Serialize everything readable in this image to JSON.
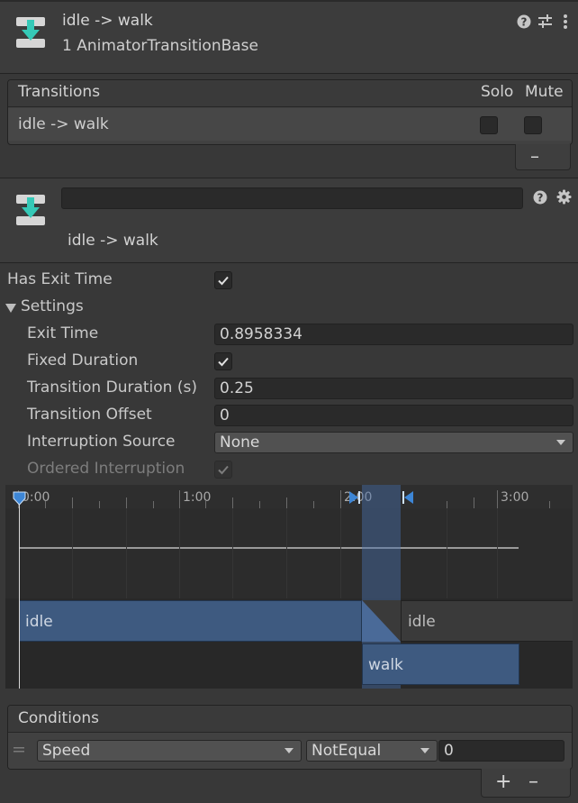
{
  "header": {
    "title": "idle -> walk",
    "subtitle": "1 AnimatorTransitionBase",
    "icons": [
      "help-icon",
      "preset-icon",
      "more-icon"
    ]
  },
  "transitions": {
    "heading": "Transitions",
    "col_solo": "Solo",
    "col_mute": "Mute",
    "rows": [
      {
        "label": "idle -> walk",
        "solo": false,
        "mute": false
      }
    ],
    "remove_label": "–"
  },
  "inspector": {
    "name_value": "",
    "subtitle": "idle -> walk",
    "icons": [
      "help-icon",
      "gear-icon"
    ]
  },
  "settings": {
    "has_exit_time_label": "Has Exit Time",
    "has_exit_time": true,
    "section_label": "Settings",
    "exit_time_label": "Exit Time",
    "exit_time_value": "0.8958334",
    "fixed_duration_label": "Fixed Duration",
    "fixed_duration": true,
    "transition_duration_label": "Transition Duration (s)",
    "transition_duration_value": "0.25",
    "transition_offset_label": "Transition Offset",
    "transition_offset_value": "0",
    "interruption_source_label": "Interruption Source",
    "interruption_source_value": "None",
    "ordered_interruption_label": "Ordered Interruption",
    "ordered_interruption": true
  },
  "timeline": {
    "ruler_labels": [
      "0:00",
      "1:00",
      "2:00",
      "3:00"
    ],
    "clip_idle_label": "idle",
    "clip_idle2_label": "idle",
    "clip_walk_label": "walk",
    "colors": {
      "clip": "#3e5a80",
      "transition": "#4a6a98",
      "grey_clip": "#3a3a3a"
    }
  },
  "conditions": {
    "heading": "Conditions",
    "parameter": "Speed",
    "mode": "NotEqual",
    "value": "0",
    "add_label": "+",
    "remove_label": "–"
  }
}
